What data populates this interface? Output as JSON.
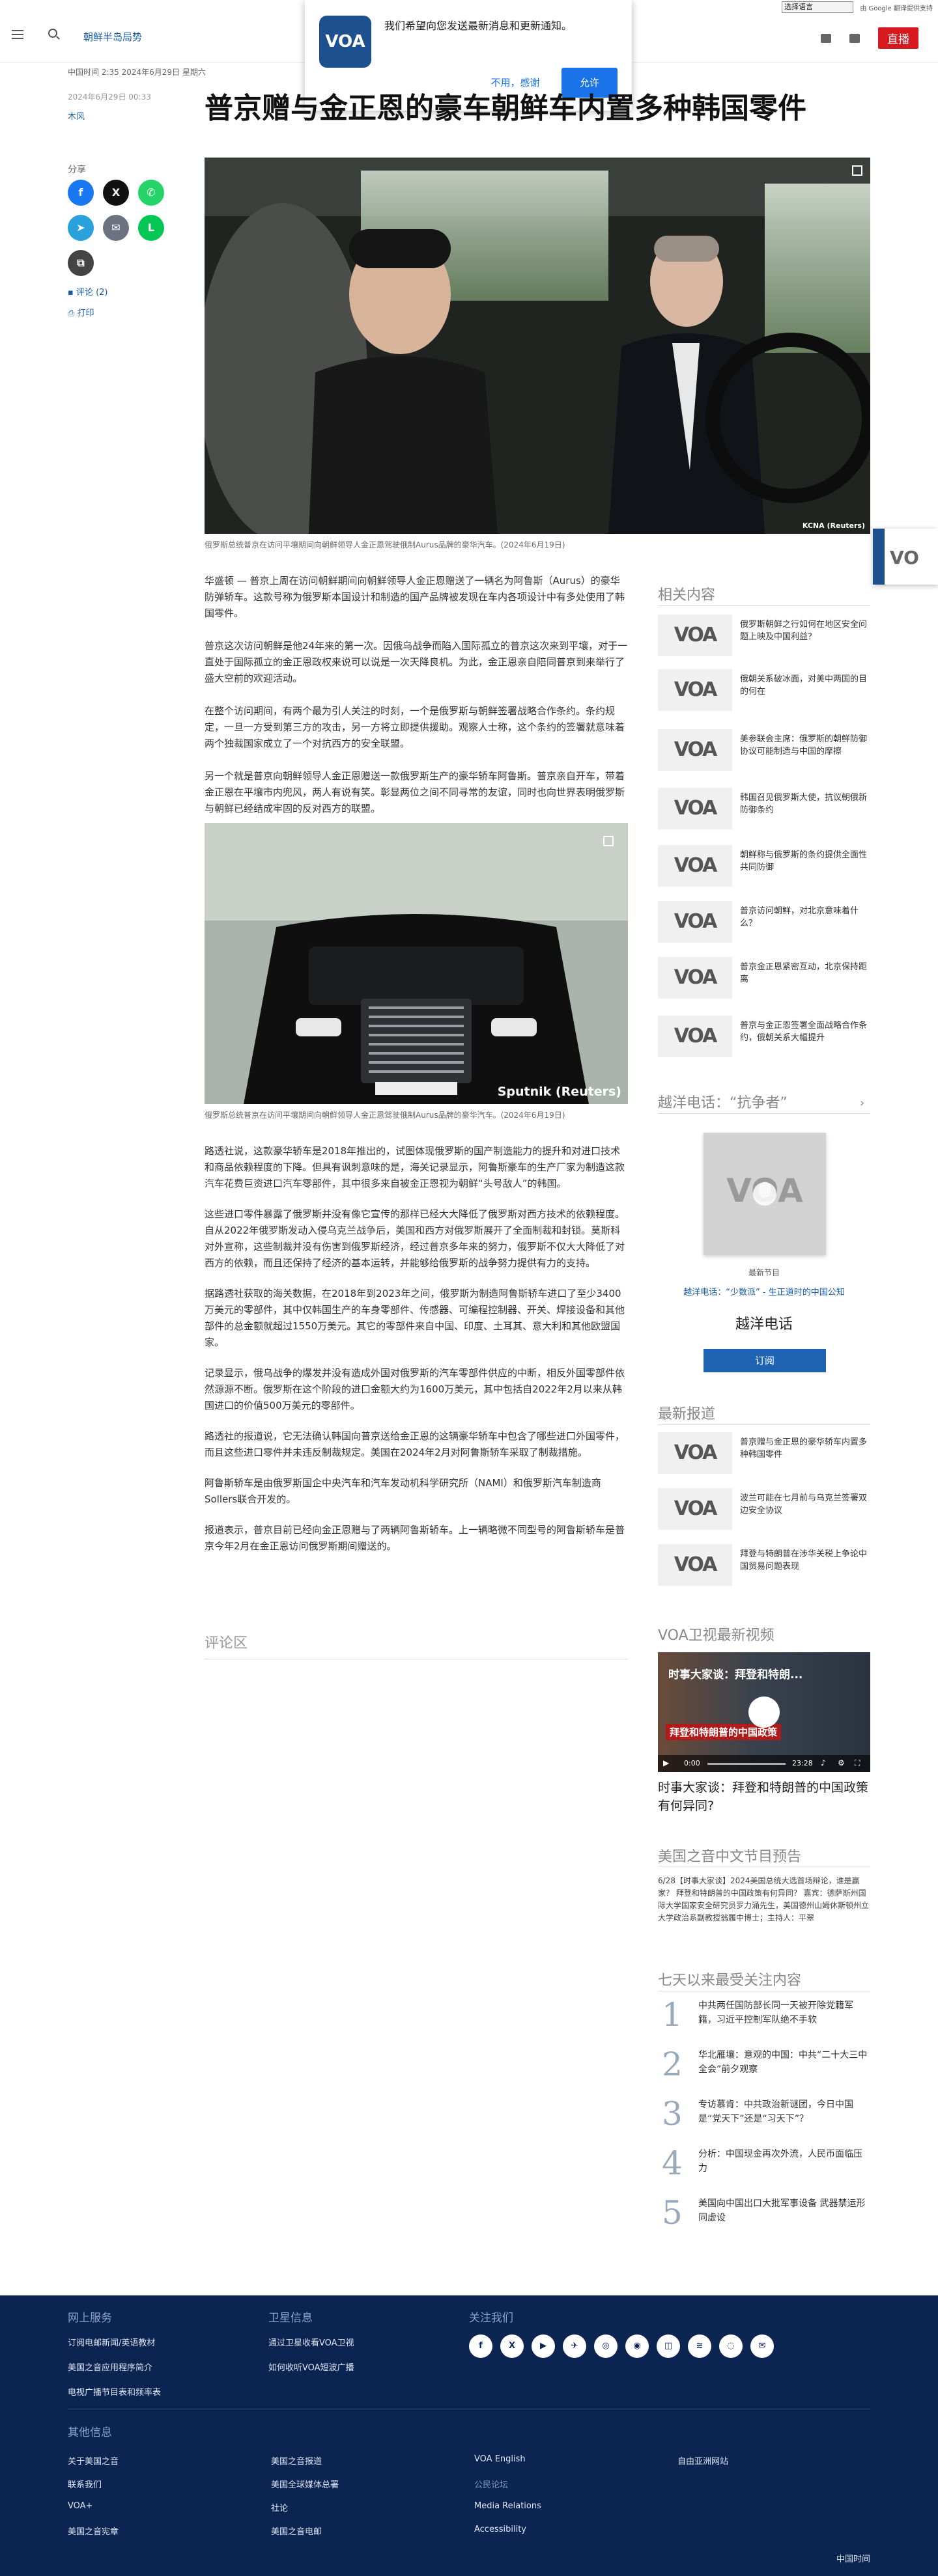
{
  "topbar": {
    "language_select": "选择语言",
    "translate_label": "由 Google 翻译提供支持"
  },
  "header": {
    "section_link": "朝鲜半岛局势",
    "live_label": "直播"
  },
  "notification": {
    "logo_text": "VOA",
    "message": "我们希望向您发送最新消息和更新通知。",
    "deny_label": "不用，感谢",
    "allow_label": "允许"
  },
  "article": {
    "meta_date": "中国时间 2:35 2024年6月29日 星期六",
    "pub_date": "2024年6月29日 00:33",
    "author": "木风",
    "title": "普京赠与金正恩的豪车朝鲜车内置多种韩国零件",
    "share_label": "分享",
    "comments_link": "评论 (2)",
    "print_link": "打印",
    "photo1_watermark": "KCNA (Reuters)",
    "photo1_caption": "俄罗斯总统普京在访问平壤期间向朝鲜领导人金正恩驾驶俄制Aurus品牌的豪华汽车。(2024年6月19日)",
    "paragraphs_a": [
      "华盛顿 — 普京上周在访问朝鲜期间向朝鲜领导人金正恩赠送了一辆名为阿鲁斯（Aurus）的豪华防弹轿车。这款号称为俄罗斯本国设计和制造的国产品牌被发现在车内各项设计中有多处使用了韩国零件。",
      "普京这次访问朝鲜是他24年来的第一次。因俄乌战争而陷入国际孤立的普京这次来到平壤，对于一直处于国际孤立的金正恩政权来说可以说是一次天降良机。为此，金正恩亲自陪同普京到来举行了盛大空前的欢迎活动。",
      "在整个访问期间，有两个最为引人关注的时刻，一个是俄罗斯与朝鲜签署战略合作条约。条约规定，一旦一方受到第三方的攻击，另一方将立即提供援助。观察人士称，这个条约的签署就意味着两个独裁国家成立了一个对抗西方的安全联盟。",
      "另一个就是普京向朝鲜领导人金正恩赠送一款俄罗斯生产的豪华轿车阿鲁斯。普京亲自开车，带着金正恩在平壤市内兜风，两人有说有笑。彰显两位之间不同寻常的友谊，同时也向世界表明俄罗斯与朝鲜已经结成牢固的反对西方的联盟。"
    ],
    "photo2_watermark": "Sputnik (Reuters)",
    "photo2_caption": "俄罗斯总统普京在访问平壤期间向朝鲜领导人金正恩驾驶俄制Aurus品牌的豪华汽车。(2024年6月19日)",
    "paragraphs_b": [
      "路透社说，这款豪华轿车是2018年推出的，试图体现俄罗斯的国产制造能力的提升和对进口技术和商品依赖程度的下降。但具有讽刺意味的是，海关记录显示，阿鲁斯豪车的生产厂家为制造这款汽车花费巨资进口汽车零部件，其中很多来自被金正恩视为朝鲜“头号敌人”的韩国。",
      "这些进口零件暴露了俄罗斯并没有像它宣传的那样已经大大降低了俄罗斯对西方技术的依赖程度。自从2022年俄罗斯发动入侵乌克兰战争后，美国和西方对俄罗斯展开了全面制裁和封锁。莫斯科对外宣称，这些制裁并没有伤害到俄罗斯经济，经过普京多年来的努力，俄罗斯不仅大大降低了对西方的依赖，而且还保持了经济的基本运转，并能够给俄罗斯的战争努力提供有力的支持。",
      "据路透社获取的海关数据，在2018年到2023年之间，俄罗斯为制造阿鲁斯轿车进口了至少3400万美元的零部件，其中仅韩国生产的车身零部件、传感器、可编程控制器、开关、焊接设备和其他部件的总金额就超过1550万美元。其它的零部件来自中国、印度、土耳其、意大利和其他欧盟国家。",
      "记录显示，俄乌战争的爆发并没有造成外国对俄罗斯的汽车零部件供应的中断，相反外国零部件依然源源不断。俄罗斯在这个阶段的进口金额大约为1600万美元，其中包括自2022年2月以来从韩国进口的价值500万美元的零部件。",
      "路透社的报道说，它无法确认韩国向普京送给金正恩的这辆豪华轿车中包含了哪些进口外国零件，而且这些进口零件并未违反制裁规定。美国在2024年2月对阿鲁斯轿车采取了制裁措施。",
      "阿鲁斯轿车是由俄罗斯国企中央汽车和汽车发动机科学研究所（NAMI）和俄罗斯汽车制造商Sollers联合开发的。",
      "报道表示，普京目前已经向金正恩赠与了两辆阿鲁斯轿车。上一辆略微不同型号的阿鲁斯轿车是普京今年2月在金正恩访问俄罗斯期间赠送的。"
    ],
    "comments_title": "评论区"
  },
  "sidebar": {
    "related_title": "相关内容",
    "related": [
      {
        "thumb": "VOA",
        "text": "俄罗斯朝鲜之行如何在地区安全问题上映及中国利益？"
      },
      {
        "thumb": "VOA",
        "text": "俄朝关系破冰面，对美中两国的目的何在"
      },
      {
        "thumb": "VOA",
        "text": "美参联会主席：俄罗斯的朝鲜防御协议可能制造与中国的摩擦"
      },
      {
        "thumb": "VOA",
        "text": "韩国召见俄罗斯大使，抗议朝俄新防御条约"
      },
      {
        "thumb": "VOA",
        "text": "朝鲜称与俄罗斯的条约提供全面性共同防御"
      },
      {
        "thumb": "VOA",
        "text": "普京访问朝鲜，对北京意味着什么？"
      },
      {
        "thumb": "VOA",
        "text": "普京金正恩紧密互动，北京保持距离"
      },
      {
        "thumb": "VOA",
        "text": "普京与金正恩签署全面战略合作条约，俄朝关系大幅提升"
      }
    ],
    "podcast_title": "越洋电话：“抗争者”",
    "podcast_label": "最新节目",
    "podcast_episode": "越洋电话：“少数派” - 生正道时的中国公知",
    "podcast_name": "越洋电话",
    "subscribe_label": "订阅",
    "latest_title": "最新报道",
    "latest": [
      {
        "thumb": "VOA",
        "text": "普京赠与金正恩的豪华轿车内置多种韩国零件"
      },
      {
        "thumb": "VOA",
        "text": "波兰可能在七月前与乌克兰签署双边安全协议"
      },
      {
        "thumb": "VOA",
        "text": "拜登与特朗普在涉华关税上争论中国贸易问题表现"
      }
    ],
    "video_title": "VOA卫视最新视频",
    "video_overlay_top": "时事大家谈：拜登和特朗...",
    "video_overlay_bottom": "拜登和特朗普的中国政策",
    "video_time_current": "0:00",
    "video_time_total": "23:28",
    "video_caption": "时事大家谈：拜登和特朗普的中国政策有何异同?",
    "schedule_title": "美国之音中文节目预告",
    "schedule_text": "6/28【时事大家谈】2024美国总统大选首场辩论，谁是赢家？ 拜登和特朗普的中国政策有何异同？ 嘉宾：德萨斯州国际大学国家安全研究员罗力涌先生，美国德州山姆休斯顿州立大学政治系副教授翁履中博士；主持人：平翠",
    "popular_title": "七天以来最受关注内容",
    "popular": [
      {
        "rank": "1",
        "text": "中共两任国防部长同一天被开除党籍军籍，习近平控制军队绝不手软"
      },
      {
        "rank": "2",
        "text": "华北雁壤：意观的中国：中共“二十大三中全会”前夕观察"
      },
      {
        "rank": "3",
        "text": "专访慕肯：中共政治新谜团，今日中国是“党天下”还是“习天下”？"
      },
      {
        "rank": "4",
        "text": "分析：中国现金再次外流，人民币面临压力"
      },
      {
        "rank": "5",
        "text": "美国向中国出口大批军事设备 武器禁运形同虚设"
      }
    ]
  },
  "footer": {
    "col1_title": "网上服务",
    "col1_links": [
      "订阅电邮新闻/英语教材",
      "美国之音应用程序简介",
      "电视广播节目表和频率表"
    ],
    "col2_title": "卫星信息",
    "col2_links": [
      "通过卫星收看VOA卫视",
      "如何收听VOA短波广播"
    ],
    "col3_title": "关注我们",
    "socials": [
      "f",
      "X",
      "▶",
      "✈",
      "◎",
      "◉",
      "◫",
      "≋",
      "◌",
      "✉"
    ],
    "other_title": "其他信息",
    "other_links": [
      [
        "关于美国之音",
        "美国之音报道",
        "VOA English",
        "自由亚洲网站"
      ],
      [
        "联系我们",
        "美国全球媒体总署",
        "公民论坛",
        ""
      ],
      [
        "VOA+",
        "社论",
        "Media Relations",
        ""
      ],
      [
        "美国之音宪章",
        "美国之音电邮",
        "Accessibility",
        ""
      ]
    ],
    "china_time": "中国时间"
  },
  "colors": {
    "brand": "#1e4f8e",
    "live": "#d71920",
    "footer_bg": "#0c2451",
    "link": "#1a5ca8"
  }
}
